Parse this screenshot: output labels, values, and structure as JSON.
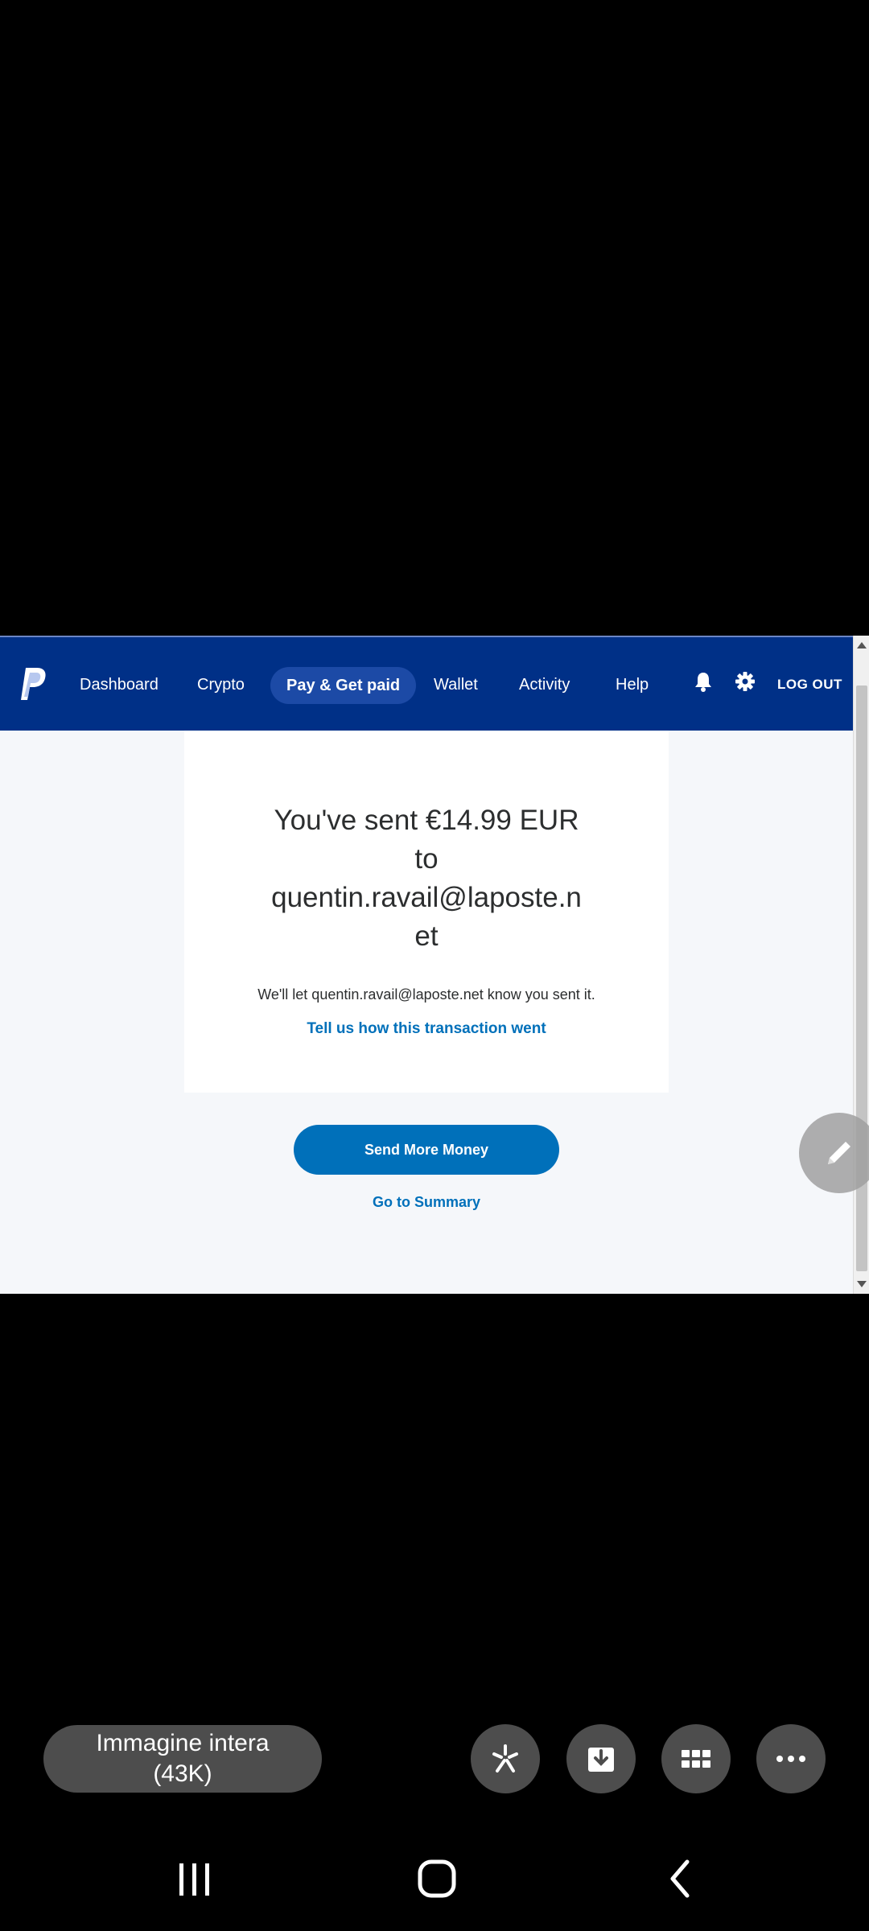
{
  "navbar": {
    "items": [
      {
        "label": "Dashboard"
      },
      {
        "label": "Crypto"
      },
      {
        "label": "Pay & Get paid",
        "active": true
      },
      {
        "label": "Wallet"
      },
      {
        "label": "Activity"
      },
      {
        "label": "Help"
      }
    ],
    "logout_label": "LOG OUT",
    "icons": [
      "paypal-logo",
      "bell-icon",
      "gear-icon"
    ]
  },
  "confirmation": {
    "headline_lines": [
      "You've sent €14.99 EUR",
      "to",
      "quentin.ravail@laposte.n",
      "et"
    ],
    "notice": "We'll let quentin.ravail@laposte.net know you sent it.",
    "feedback_link": "Tell us how this transaction went"
  },
  "actions": {
    "send_more": "Send More Money",
    "summary": "Go to Summary"
  },
  "viewer": {
    "pill_lines": [
      "Immagine intera",
      "(43K)"
    ],
    "buttons": [
      "sparkle-icon",
      "download-icon",
      "grid-icon",
      "more-icon"
    ]
  },
  "colors": {
    "nav_background": "#003087",
    "accent": "#0070ba"
  }
}
